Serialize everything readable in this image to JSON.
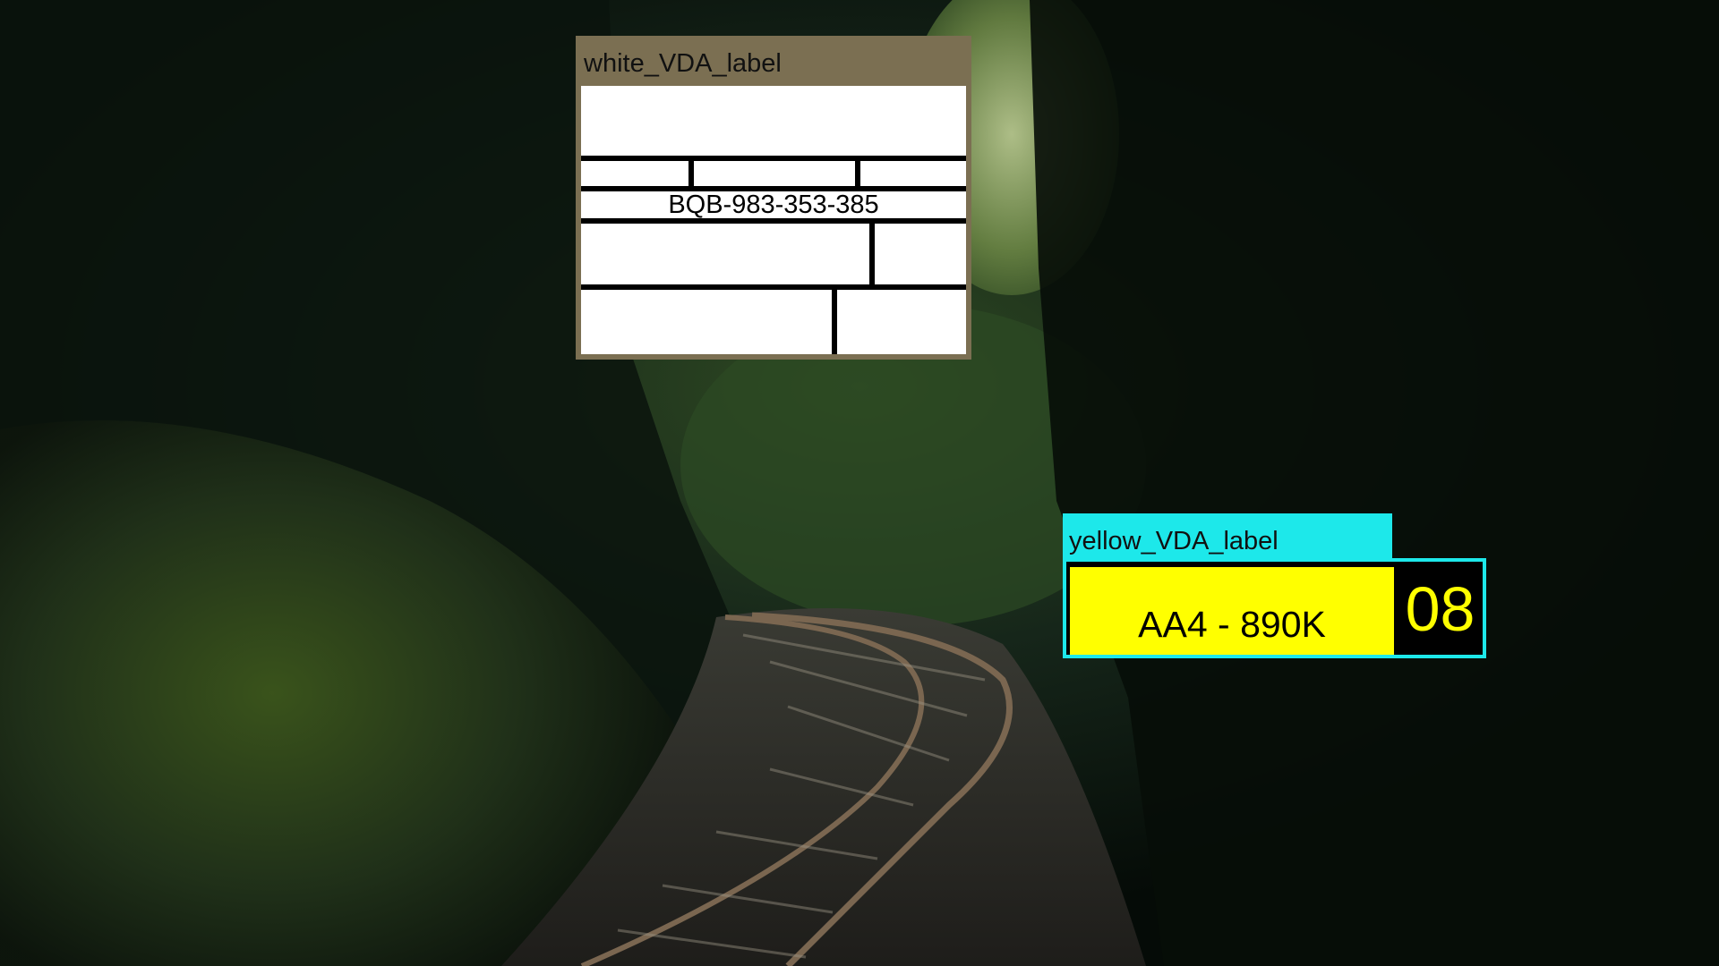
{
  "white_label": {
    "title": "white_VDA_label",
    "code": "BQB-983-353-385",
    "frame_color": "#7b6f52"
  },
  "yellow_label": {
    "title": "yellow_VDA_label",
    "text": "AA4 - 890K",
    "number": "08",
    "frame_color": "#1de8ea",
    "fill_color": "#ffff00"
  }
}
